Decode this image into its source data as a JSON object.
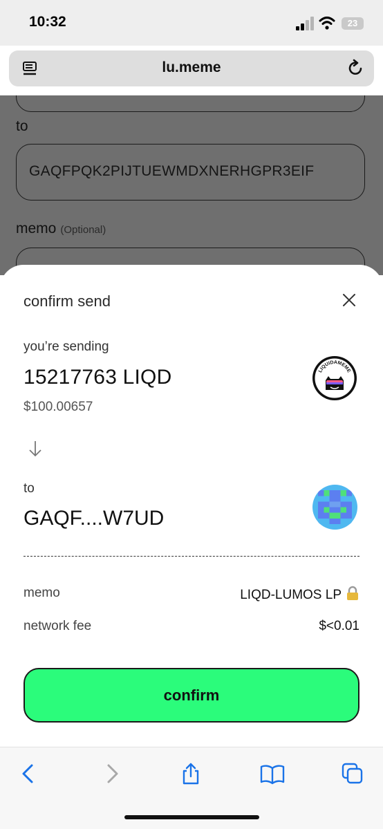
{
  "status_bar": {
    "time": "10:32",
    "battery": "23"
  },
  "browser": {
    "url": "lu.meme"
  },
  "background_form": {
    "to_label": "to",
    "to_value": "GAQFPQK2PIJTUEWMDXNERHGPR3EIF",
    "memo_label": "memo",
    "memo_optional": "(Optional)"
  },
  "sheet": {
    "title": "confirm send",
    "sending_label": "you’re sending",
    "amount": "15217763 LIQD",
    "usd_value": "$100.00657",
    "token_logo_text": "LIQUIDAMEME",
    "to_label": "to",
    "address": "GAQF....W7UD",
    "details": [
      {
        "label": "memo",
        "value": "LIQD-LUMOS LP"
      },
      {
        "label": "network fee",
        "value": "$<0.01"
      }
    ],
    "confirm_label": "confirm"
  },
  "colors": {
    "confirm": "#2bfc7b",
    "link": "#1a73e8",
    "overlay": "#6f6f6f"
  },
  "icons": [
    "menu-icon",
    "reload-icon",
    "close-icon",
    "arrow-down-icon",
    "lock-icon",
    "back-icon",
    "forward-icon",
    "share-icon",
    "bookmarks-icon",
    "tabs-icon"
  ]
}
